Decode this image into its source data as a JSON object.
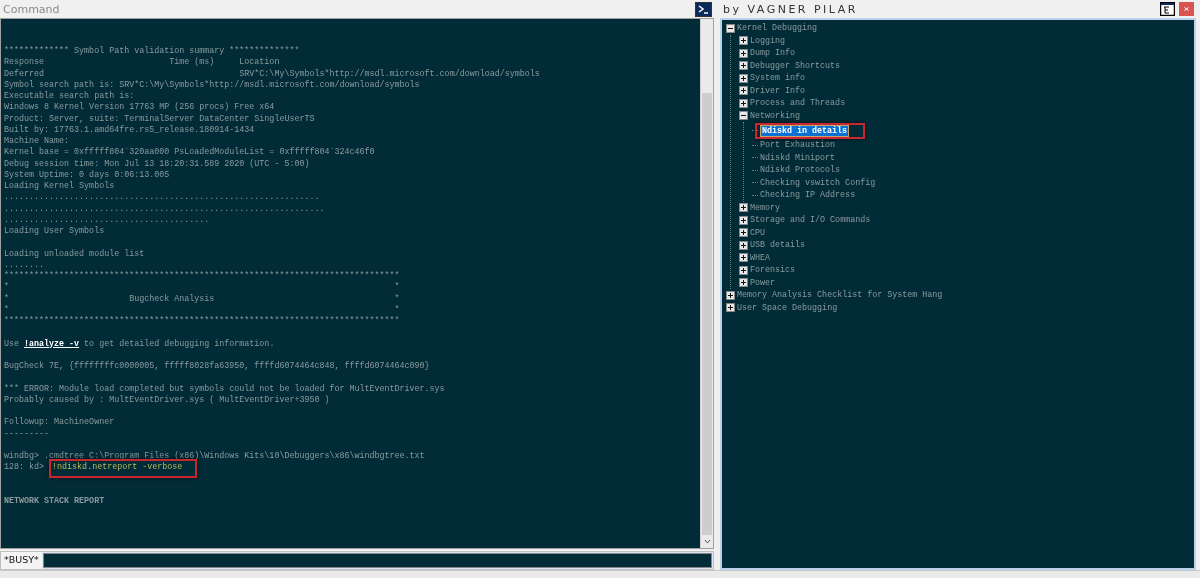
{
  "command_window": {
    "title": "Command",
    "lines": [
      {
        "kind": "text",
        "text": "************* Symbol Path validation summary **************"
      },
      {
        "kind": "text",
        "text": "Response                         Time (ms)     Location"
      },
      {
        "kind": "text",
        "text": "Deferred                                       SRV*C:\\My\\Symbols*http://msdl.microsoft.com/download/symbols"
      },
      {
        "kind": "text",
        "text": "Symbol search path is: SRV*C:\\My\\Symbols*http://msdl.microsoft.com/download/symbols"
      },
      {
        "kind": "text",
        "text": "Executable search path is:"
      },
      {
        "kind": "text",
        "text": "Windows 8 Kernel Version 17763 MP (256 procs) Free x64"
      },
      {
        "kind": "text",
        "text": "Product: Server, suite: TerminalServer DataCenter SingleUserTS"
      },
      {
        "kind": "text",
        "text": "Built by: 17763.1.amd64fre.rs5_release.180914-1434"
      },
      {
        "kind": "text",
        "text": "Machine Name:"
      },
      {
        "kind": "text",
        "text": "Kernel base = 0xfffff804`320aa000 PsLoadedModuleList = 0xfffff804`324c46f0"
      },
      {
        "kind": "text",
        "text": "Debug session time: Mon Jul 13 18:20:31.589 2020 (UTC - 5:00)"
      },
      {
        "kind": "text",
        "text": "System Uptime: 0 days 0:06:13.005"
      },
      {
        "kind": "text",
        "text": "Loading Kernel Symbols"
      },
      {
        "kind": "text",
        "text": "..............................................................."
      },
      {
        "kind": "text",
        "text": "................................................................"
      },
      {
        "kind": "text",
        "text": "........................................."
      },
      {
        "kind": "text",
        "text": "Loading User Symbols"
      },
      {
        "kind": "blank"
      },
      {
        "kind": "text",
        "text": "Loading unloaded module list"
      },
      {
        "kind": "text",
        "text": "........"
      },
      {
        "kind": "block",
        "text": "*******************************************************************************\n*                                                                             *\n*                        Bugcheck Analysis                                    *\n*                                                                             *\n*******************************************************************************"
      },
      {
        "kind": "blank"
      },
      {
        "kind": "link",
        "before": "Use ",
        "link": "!analyze -v",
        "after": " to get detailed debugging information."
      },
      {
        "kind": "blank"
      },
      {
        "kind": "text",
        "text": "BugCheck 7E, {ffffffffc0000005, fffff8028fa63950, ffffd6074464c848, ffffd6074464c090}"
      },
      {
        "kind": "blank"
      },
      {
        "kind": "text",
        "text": "*** ERROR: Module load completed but symbols could not be loaded for MultEventDriver.sys"
      },
      {
        "kind": "text",
        "text": "Probably caused by : MultEventDriver.sys ( MultEventDriver+3950 )"
      },
      {
        "kind": "blank"
      },
      {
        "kind": "text",
        "text": "Followup: MachineOwner"
      },
      {
        "kind": "text",
        "text": "---------"
      },
      {
        "kind": "blank"
      },
      {
        "kind": "text",
        "text": "windbg> .cmdtree C:\\Program Files (x86)\\Windows Kits\\10\\Debuggers\\x86\\windbgtree.txt"
      },
      {
        "kind": "prompt",
        "prompt": "128: kd>",
        "command": "!ndiskd.netreport -verbose",
        "highlighted": true
      },
      {
        "kind": "blank"
      },
      {
        "kind": "blank"
      },
      {
        "kind": "bold",
        "text": "NETWORK STACK REPORT"
      }
    ],
    "status_label": "*BUSY*"
  },
  "tree_window": {
    "title": "by VAGNER PILAR",
    "tree": [
      {
        "label": "Kernel Debugging",
        "expanded": true,
        "children": [
          {
            "label": "Logging",
            "expanded": false
          },
          {
            "label": "Dump Info",
            "expanded": false
          },
          {
            "label": "Debugger Shortcuts",
            "expanded": false
          },
          {
            "label": "System info",
            "expanded": false
          },
          {
            "label": "Driver Info",
            "expanded": false
          },
          {
            "label": "Process and Threads",
            "expanded": false
          },
          {
            "label": "Networking",
            "expanded": true,
            "children": [
              {
                "label": "Ndiskd in details",
                "selected": true,
                "highlighted": true
              },
              {
                "label": "Port Exhaustion",
                "selected": false
              },
              {
                "label": "Ndiskd Miniport",
                "selected": false
              },
              {
                "label": "Ndiskd Protocols",
                "selected": false
              },
              {
                "label": "Checking vswitch Config",
                "selected": false
              },
              {
                "label": "Checking IP Address",
                "selected": false
              }
            ]
          },
          {
            "label": "Memory",
            "expanded": false
          },
          {
            "label": "Storage and I/O Commands",
            "expanded": false
          },
          {
            "label": "CPU",
            "expanded": false
          },
          {
            "label": "USB details",
            "expanded": false
          },
          {
            "label": "WHEA",
            "expanded": false
          },
          {
            "label": "Forensics",
            "expanded": false
          },
          {
            "label": "Power",
            "expanded": false
          }
        ]
      },
      {
        "label": "Memory Analysis Checklist for System Hang",
        "expanded": false
      },
      {
        "label": "User Space Debugging",
        "expanded": false
      }
    ]
  }
}
